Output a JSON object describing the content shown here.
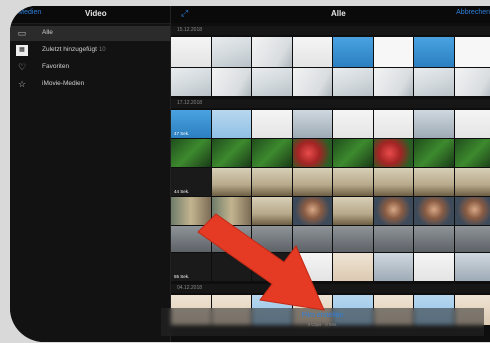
{
  "sidebar": {
    "back_label": "Medien",
    "title": "Video",
    "items": [
      {
        "icon": "film-icon",
        "label": "Alle",
        "badge": ""
      },
      {
        "icon": "recently-added-icon",
        "label": "Zuletzt hinzugefügt",
        "badge": "10"
      },
      {
        "icon": "heart-icon",
        "label": "Favoriten",
        "badge": ""
      },
      {
        "icon": "star-icon",
        "label": "iMovie-Medien",
        "badge": ""
      }
    ]
  },
  "main": {
    "title": "Alle",
    "cancel_label": "Abbrechen",
    "sections": [
      {
        "date": "15.12.2018"
      },
      {
        "date": "17.12.2018"
      },
      {
        "date": "04.12.2018"
      }
    ],
    "durations": [
      "47 Sek.",
      "44 Sek.",
      "55 Sek."
    ]
  },
  "footer": {
    "create_label": "Film erstellen",
    "subtitle": "3 Clips · 0 Min."
  },
  "colors": {
    "accent": "#2f7fdc",
    "arrow": "#e53a24"
  }
}
